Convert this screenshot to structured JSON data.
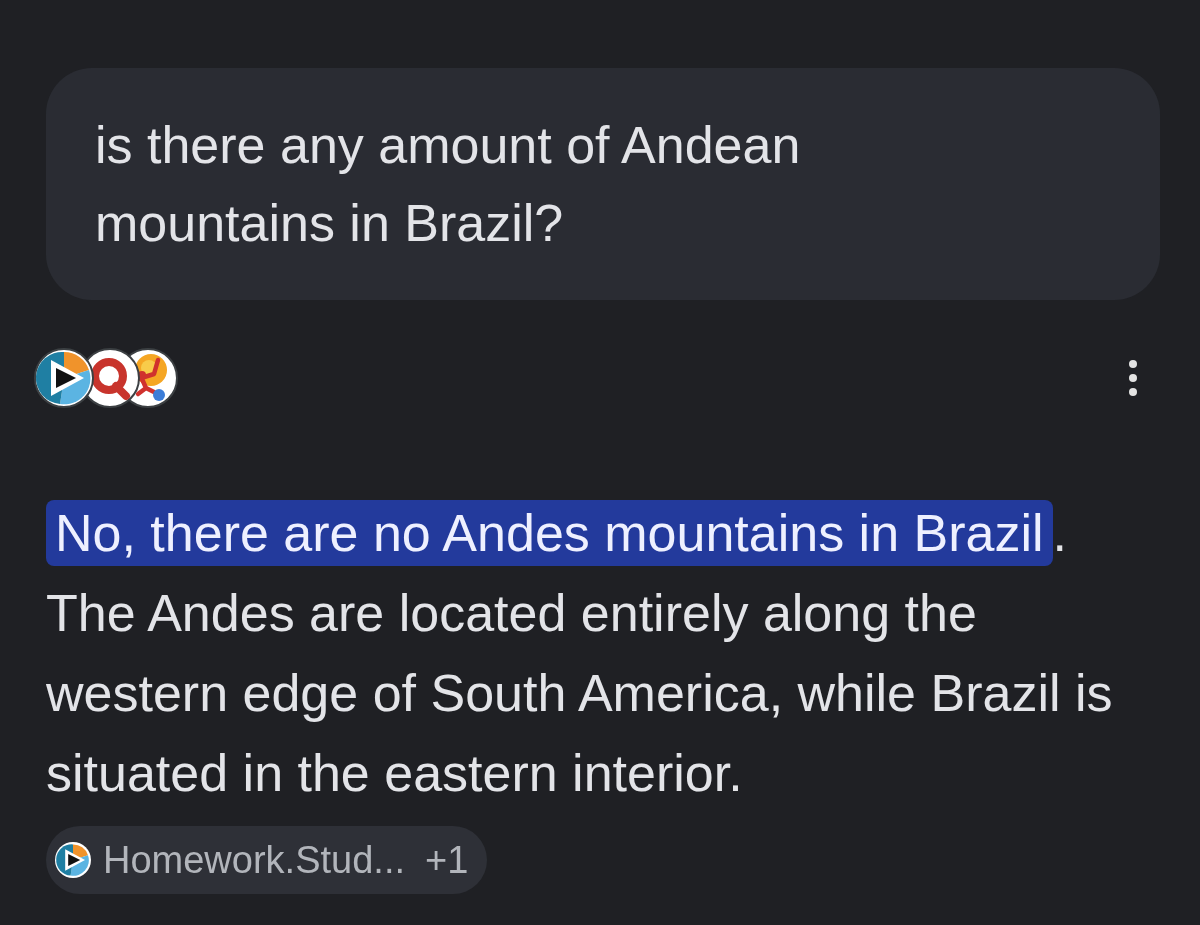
{
  "query": {
    "text": "is there any amount of Andean mountains in Brazil?"
  },
  "answer": {
    "lead": {
      "text": "No, there are no Andes mountains in Brazil",
      "highlighted": true
    },
    "lead_end": ".",
    "body": "The Andes are located entirely along the western edge of South America, while Brazil is situated in the eastern interior."
  },
  "source_chip": {
    "label": "Homework.Stud...",
    "count": "+1"
  }
}
